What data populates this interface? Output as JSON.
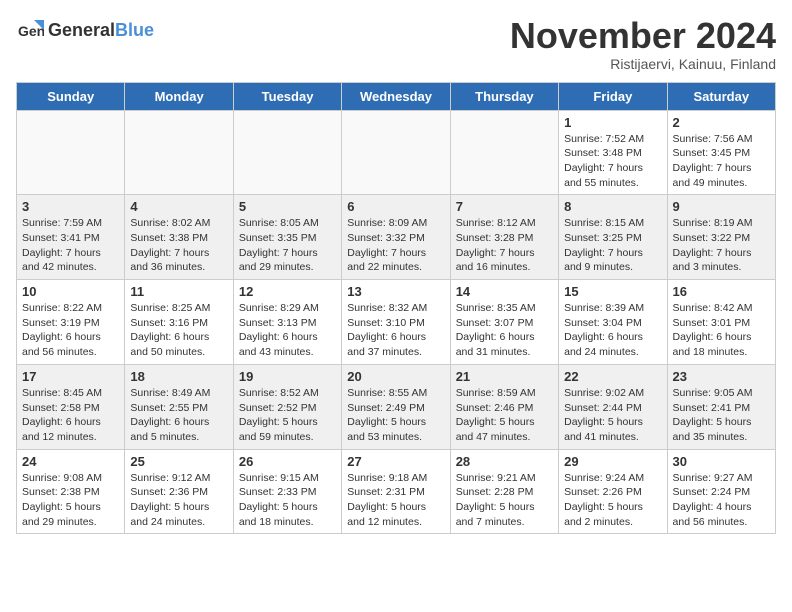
{
  "logo": {
    "text_general": "General",
    "text_blue": "Blue"
  },
  "title": {
    "month_year": "November 2024",
    "location": "Ristijaervi, Kainuu, Finland"
  },
  "weekdays": [
    "Sunday",
    "Monday",
    "Tuesday",
    "Wednesday",
    "Thursday",
    "Friday",
    "Saturday"
  ],
  "weeks": [
    [
      {
        "day": "",
        "info": ""
      },
      {
        "day": "",
        "info": ""
      },
      {
        "day": "",
        "info": ""
      },
      {
        "day": "",
        "info": ""
      },
      {
        "day": "",
        "info": ""
      },
      {
        "day": "1",
        "info": "Sunrise: 7:52 AM\nSunset: 3:48 PM\nDaylight: 7 hours and 55 minutes."
      },
      {
        "day": "2",
        "info": "Sunrise: 7:56 AM\nSunset: 3:45 PM\nDaylight: 7 hours and 49 minutes."
      }
    ],
    [
      {
        "day": "3",
        "info": "Sunrise: 7:59 AM\nSunset: 3:41 PM\nDaylight: 7 hours and 42 minutes."
      },
      {
        "day": "4",
        "info": "Sunrise: 8:02 AM\nSunset: 3:38 PM\nDaylight: 7 hours and 36 minutes."
      },
      {
        "day": "5",
        "info": "Sunrise: 8:05 AM\nSunset: 3:35 PM\nDaylight: 7 hours and 29 minutes."
      },
      {
        "day": "6",
        "info": "Sunrise: 8:09 AM\nSunset: 3:32 PM\nDaylight: 7 hours and 22 minutes."
      },
      {
        "day": "7",
        "info": "Sunrise: 8:12 AM\nSunset: 3:28 PM\nDaylight: 7 hours and 16 minutes."
      },
      {
        "day": "8",
        "info": "Sunrise: 8:15 AM\nSunset: 3:25 PM\nDaylight: 7 hours and 9 minutes."
      },
      {
        "day": "9",
        "info": "Sunrise: 8:19 AM\nSunset: 3:22 PM\nDaylight: 7 hours and 3 minutes."
      }
    ],
    [
      {
        "day": "10",
        "info": "Sunrise: 8:22 AM\nSunset: 3:19 PM\nDaylight: 6 hours and 56 minutes."
      },
      {
        "day": "11",
        "info": "Sunrise: 8:25 AM\nSunset: 3:16 PM\nDaylight: 6 hours and 50 minutes."
      },
      {
        "day": "12",
        "info": "Sunrise: 8:29 AM\nSunset: 3:13 PM\nDaylight: 6 hours and 43 minutes."
      },
      {
        "day": "13",
        "info": "Sunrise: 8:32 AM\nSunset: 3:10 PM\nDaylight: 6 hours and 37 minutes."
      },
      {
        "day": "14",
        "info": "Sunrise: 8:35 AM\nSunset: 3:07 PM\nDaylight: 6 hours and 31 minutes."
      },
      {
        "day": "15",
        "info": "Sunrise: 8:39 AM\nSunset: 3:04 PM\nDaylight: 6 hours and 24 minutes."
      },
      {
        "day": "16",
        "info": "Sunrise: 8:42 AM\nSunset: 3:01 PM\nDaylight: 6 hours and 18 minutes."
      }
    ],
    [
      {
        "day": "17",
        "info": "Sunrise: 8:45 AM\nSunset: 2:58 PM\nDaylight: 6 hours and 12 minutes."
      },
      {
        "day": "18",
        "info": "Sunrise: 8:49 AM\nSunset: 2:55 PM\nDaylight: 6 hours and 5 minutes."
      },
      {
        "day": "19",
        "info": "Sunrise: 8:52 AM\nSunset: 2:52 PM\nDaylight: 5 hours and 59 minutes."
      },
      {
        "day": "20",
        "info": "Sunrise: 8:55 AM\nSunset: 2:49 PM\nDaylight: 5 hours and 53 minutes."
      },
      {
        "day": "21",
        "info": "Sunrise: 8:59 AM\nSunset: 2:46 PM\nDaylight: 5 hours and 47 minutes."
      },
      {
        "day": "22",
        "info": "Sunrise: 9:02 AM\nSunset: 2:44 PM\nDaylight: 5 hours and 41 minutes."
      },
      {
        "day": "23",
        "info": "Sunrise: 9:05 AM\nSunset: 2:41 PM\nDaylight: 5 hours and 35 minutes."
      }
    ],
    [
      {
        "day": "24",
        "info": "Sunrise: 9:08 AM\nSunset: 2:38 PM\nDaylight: 5 hours and 29 minutes."
      },
      {
        "day": "25",
        "info": "Sunrise: 9:12 AM\nSunset: 2:36 PM\nDaylight: 5 hours and 24 minutes."
      },
      {
        "day": "26",
        "info": "Sunrise: 9:15 AM\nSunset: 2:33 PM\nDaylight: 5 hours and 18 minutes."
      },
      {
        "day": "27",
        "info": "Sunrise: 9:18 AM\nSunset: 2:31 PM\nDaylight: 5 hours and 12 minutes."
      },
      {
        "day": "28",
        "info": "Sunrise: 9:21 AM\nSunset: 2:28 PM\nDaylight: 5 hours and 7 minutes."
      },
      {
        "day": "29",
        "info": "Sunrise: 9:24 AM\nSunset: 2:26 PM\nDaylight: 5 hours and 2 minutes."
      },
      {
        "day": "30",
        "info": "Sunrise: 9:27 AM\nSunset: 2:24 PM\nDaylight: 4 hours and 56 minutes."
      }
    ]
  ]
}
